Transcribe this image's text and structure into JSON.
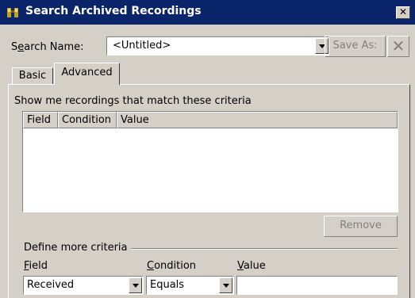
{
  "window": {
    "title": "Search Archived Recordings",
    "icon": "binoculars-icon",
    "close_glyph": "✕"
  },
  "search": {
    "label_prefix": "S",
    "label_accel": "e",
    "label_suffix": "arch Name:",
    "value": "<Untitled>",
    "save_as_label": "Save As:",
    "delete_glyph": "✕"
  },
  "tabs": [
    {
      "label": "Basic",
      "selected": false
    },
    {
      "label": "Advanced",
      "selected": true
    }
  ],
  "advanced": {
    "intro": "Show me recordings that match these criteria",
    "columns": [
      "Field",
      "Condition",
      "Value"
    ],
    "rows": [],
    "remove_label": "Remove",
    "define_label": "Define more criteria",
    "field_label_accel": "F",
    "field_label_rest": "ield",
    "condition_label_accel": "C",
    "condition_label_rest": "ondition",
    "value_label_accel": "V",
    "value_label_rest": "alue",
    "field_value": "Received",
    "condition_value": "Equals",
    "value_input": ""
  },
  "colors": {
    "titlebar": "#0a246a",
    "face": "#d4d0c8",
    "disabled_text": "#808080"
  }
}
